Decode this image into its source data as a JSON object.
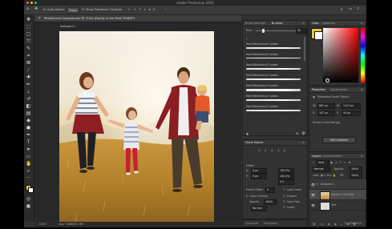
{
  "window": {
    "title": "Adobe Photoshop 2020"
  },
  "options_bar": {
    "auto_select_label": "Auto-Select:",
    "auto_select_value": "Group",
    "show_transform_label": "Show Transform Controls"
  },
  "document": {
    "tab_title": "PhotoScene Example.psd @ 110% (Family in the field, RGB/8*)",
    "artboard_name": "Artboard 1",
    "zoom": "110%",
    "doc_info": "Doc: 3.66M/8.19M"
  },
  "brushes_panel": {
    "tabs": [
      "Brush Settings",
      "Brushes"
    ],
    "active_tab": "Brushes",
    "size_value": "30",
    "brushes": [
      "Hard Mechanical 7 pixels",
      "Hard Mechanical 3 pixels",
      "Hard Mechanical 5 pixels",
      "Hard Mechanical 5 pixels",
      "Hard Mechanical 9 pixels",
      "Hard Mechanical 7 pixels",
      "Hard Mechanical 5 pixels"
    ]
  },
  "clone_source_panel": {
    "title": "Clone Source",
    "offset_label": "Offset:",
    "x_label": "X:",
    "y_label": "Y:",
    "x_value": "0 px",
    "y_value": "0 px",
    "w_value": "100.0%",
    "h_value": "100.0%",
    "angle_value": "0.0",
    "frame_offset_label": "Frame Offset:",
    "frame_offset_value": "0",
    "lock_frame_label": "Lock Frame",
    "show_overlay_label": "Show Overlay",
    "opacity_label": "Opacity:",
    "opacity_value": "100%",
    "normal_label": "Normal",
    "clipped_label": "Clipped",
    "auto_hide_label": "Auto Hide",
    "invert_label": "Invert"
  },
  "character_tabs": [
    "Character",
    "Paragraph"
  ],
  "color_panel": {
    "tabs": [
      "Color",
      "Swatches"
    ],
    "active_tab": "Color",
    "selected_hue": "#ff0000"
  },
  "properties_panel": {
    "tabs": [
      "Properties",
      "Adjustments"
    ],
    "active_tab": "Properties",
    "object_type": "Embedded Smart Object",
    "w_label": "W:",
    "w_value": "887 px",
    "h_label": "H:",
    "h_value": "1127 px",
    "x_label": "X:",
    "x_value": "187 px",
    "y_label": "Y:",
    "y_value": "44 px",
    "file_name": "Family in the field.jpg",
    "edit_button": "Edit Contents"
  },
  "layers_panel": {
    "tabs": [
      "Layers",
      "Channels",
      "Paths"
    ],
    "active_tab": "Layers",
    "kind_label": "Kind",
    "blend_mode": "Normal",
    "opacity_label": "Opacity:",
    "opacity_value": "100%",
    "lock_label": "Lock:",
    "fill_label": "Fill:",
    "fill_value": "100%",
    "layers": [
      {
        "name": "Artboard 1",
        "type": "group"
      },
      {
        "name": "Family in the field",
        "type": "smart-object"
      },
      {
        "name": "Text",
        "type": "layer"
      }
    ]
  },
  "watermark": "lynda.com",
  "colors": {
    "ui_dark": "#323232",
    "ui_darker": "#282828",
    "selection": "#4a4a4a",
    "accent": "#3d7bd6"
  }
}
